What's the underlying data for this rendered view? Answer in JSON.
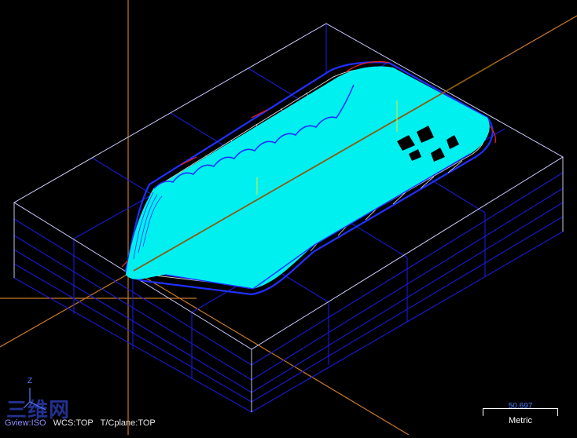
{
  "viewport": {
    "background": "#000000",
    "colors": {
      "stock_box": "#1a1ad8",
      "stock_outline": "#e0e0e0",
      "toolpath": "#00f0f0",
      "part_wire": "#c8c8c8",
      "part_edge": "#2030ff",
      "edge_red": "#e02020",
      "axis_line": "#c87828",
      "vertical_marker": "#e8e830"
    }
  },
  "status_bar": {
    "gview": "Gview:ISO",
    "wcs": "WCS:TOP",
    "tcplane": "T/Cplane:TOP"
  },
  "triad": {
    "z_label": "Z"
  },
  "scale": {
    "value": "50.697",
    "units": "Metric"
  },
  "watermark": {
    "text": "三维网"
  }
}
